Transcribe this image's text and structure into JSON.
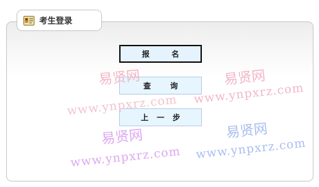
{
  "panel": {
    "title": "考生登录",
    "icon": "id-card-icon"
  },
  "buttons": {
    "register": [
      "报",
      "名"
    ],
    "query": [
      "查",
      "询"
    ],
    "back": [
      "上",
      "一",
      "步"
    ]
  },
  "watermarks": [
    {
      "cn": "易贤网",
      "url": "www.ynpxrz.com"
    }
  ],
  "colors": {
    "button_bg": "#e6f5fe",
    "button_border": "#b6cee0",
    "panel_border": "#c7c7c7",
    "watermark_pink": "#f2b3c4",
    "watermark_violet": "#d9a3f0",
    "watermark_blue": "#a8bdf2"
  }
}
